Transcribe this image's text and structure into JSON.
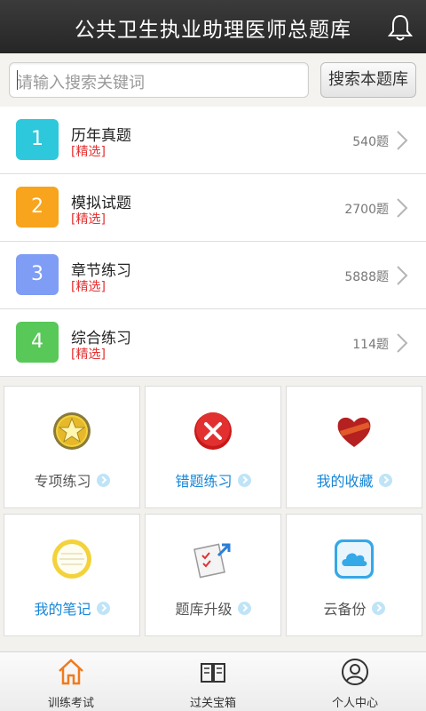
{
  "header": {
    "title": "公共卫生执业助理医师总题库",
    "bell_icon": "bell-icon"
  },
  "search": {
    "placeholder": "请输入搜索关键词",
    "button_label": "搜索本题库"
  },
  "categories": [
    {
      "number": "1",
      "name": "历年真题",
      "tag": "[精选]",
      "count": "540题",
      "color": "#2dc8dc"
    },
    {
      "number": "2",
      "name": "模拟试题",
      "tag": "[精选]",
      "count": "2700题",
      "color": "#f8a41c"
    },
    {
      "number": "3",
      "name": "章节练习",
      "tag": "[精选]",
      "count": "5888题",
      "color": "#7f9df5"
    },
    {
      "number": "4",
      "name": "综合练习",
      "tag": "[精选]",
      "count": "114题",
      "color": "#58c858"
    }
  ],
  "features": [
    {
      "label": "专项练习",
      "icon": "star-badge-icon"
    },
    {
      "label": "错题练习",
      "icon": "red-x-icon"
    },
    {
      "label": "我的收藏",
      "icon": "heart-icon"
    },
    {
      "label": "我的笔记",
      "icon": "notepad-icon"
    },
    {
      "label": "题库升级",
      "icon": "upgrade-checklist-icon"
    },
    {
      "label": "云备份",
      "icon": "cloud-icon"
    }
  ],
  "tabs": [
    {
      "label": "训练考试",
      "icon": "home-icon",
      "active": true
    },
    {
      "label": "过关宝箱",
      "icon": "book-icon",
      "active": false
    },
    {
      "label": "个人中心",
      "icon": "user-icon",
      "active": false
    }
  ],
  "colors": {
    "accent_blue": "#1787d8",
    "tag_red": "#e53030",
    "active_tab": "#f07a1c"
  }
}
